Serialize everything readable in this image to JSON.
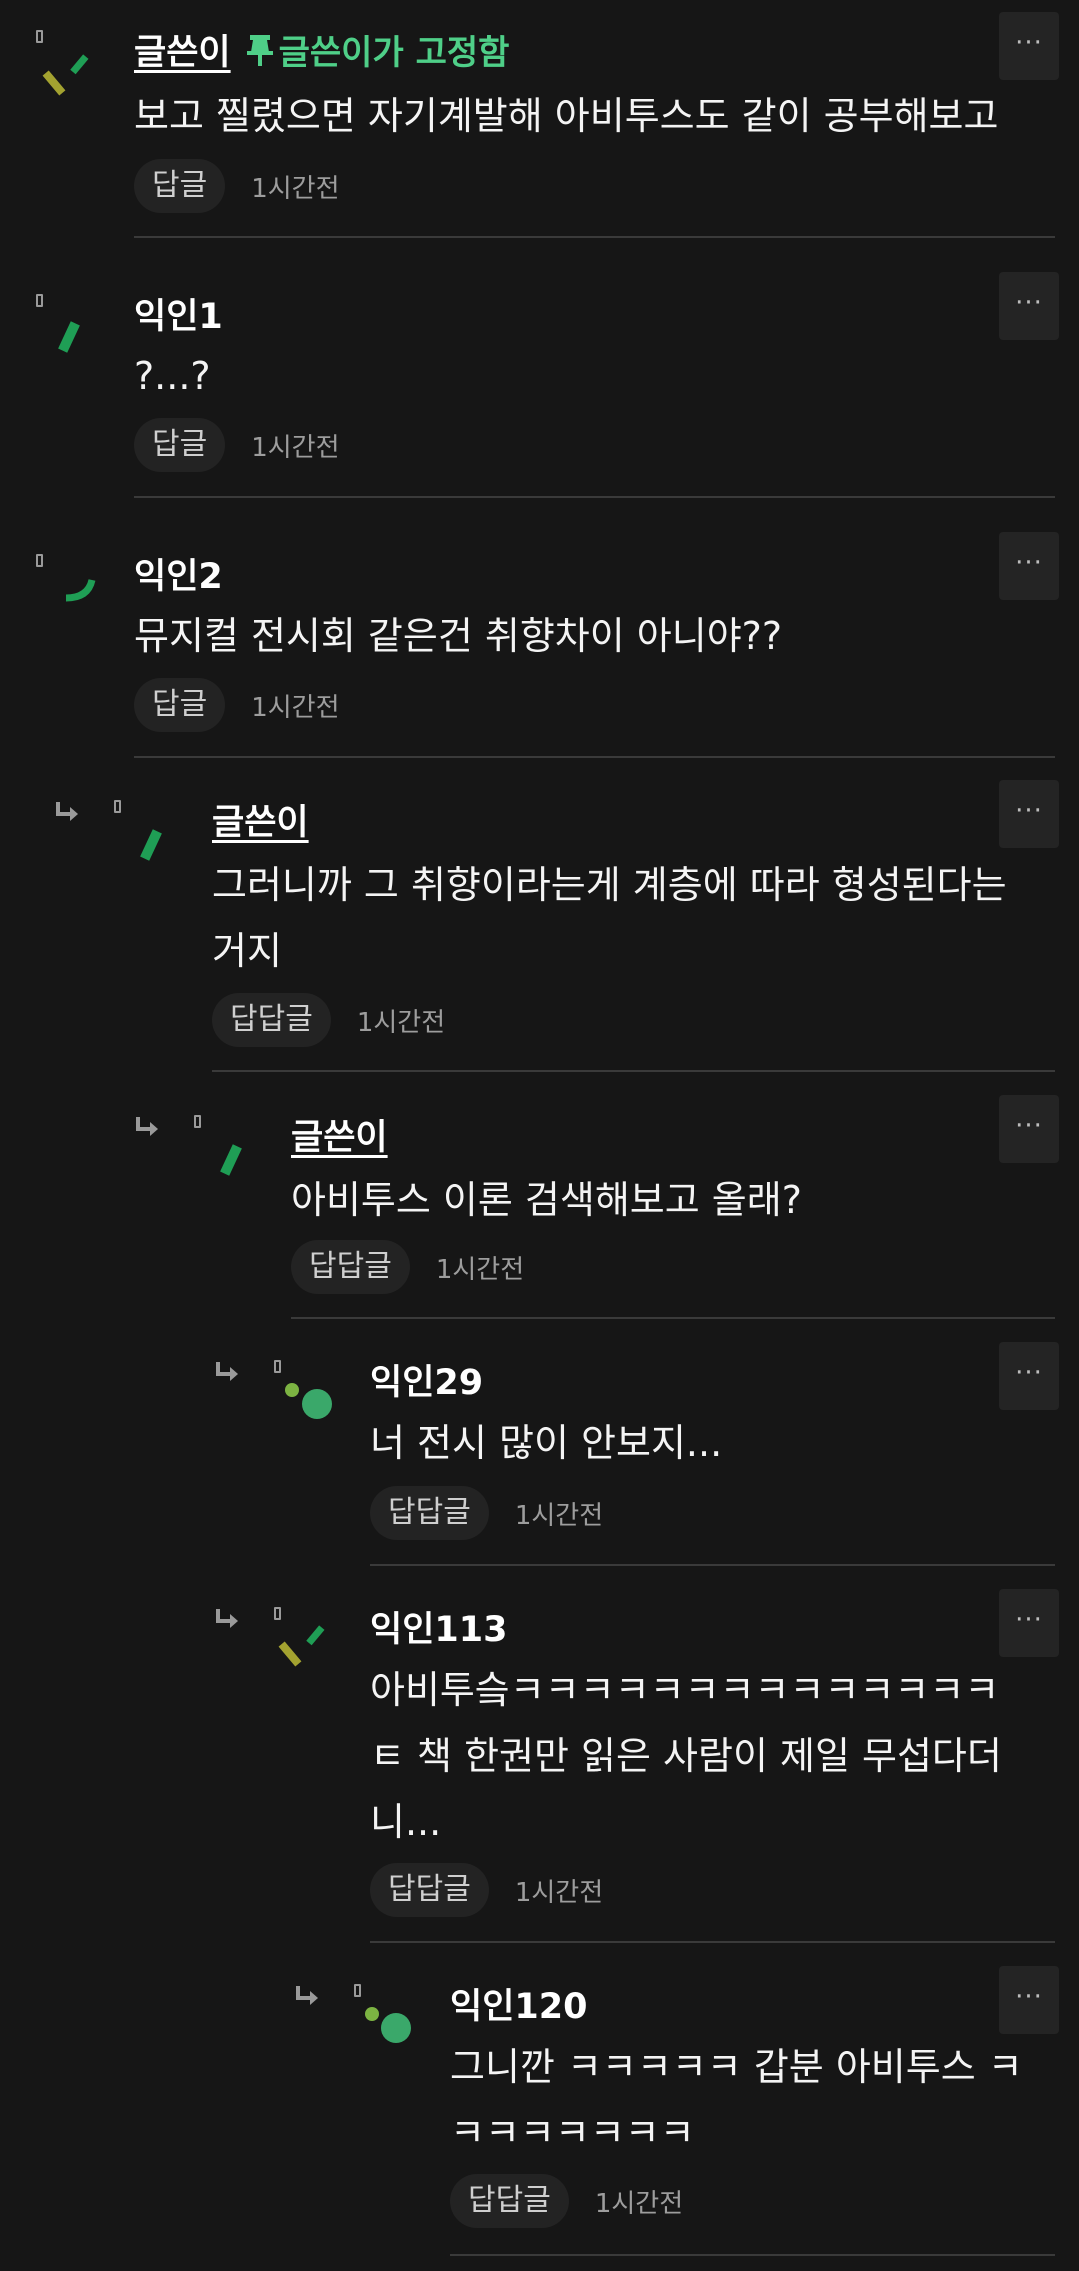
{
  "comments": [
    {
      "author": "글쓴이",
      "pinned": "글쓴이가 고정함",
      "text": "보고 찔렸으면 자기계발해 아비투스도 같이 공부해보고",
      "reply": "답글",
      "time": "1시간전",
      "more": "···"
    },
    {
      "author": "익인1",
      "text": "?...?",
      "reply": "답글",
      "time": "1시간전",
      "more": "···"
    },
    {
      "author": "익인2",
      "text": "뮤지컬 전시회 같은건 취향차이 아니야??",
      "reply": "답글",
      "time": "1시간전",
      "more": "···"
    },
    {
      "author": "글쓴이",
      "text": "그러니까 그 취향이라는게 계층에 따라 형성된다는\n거지",
      "reply": "답답글",
      "time": "1시간전",
      "more": "···"
    },
    {
      "author": "글쓴이",
      "text": "아비투스 이론 검색해보고 올래?",
      "reply": "답답글",
      "time": "1시간전",
      "more": "···"
    },
    {
      "author": "익인29",
      "text": "너 전시 많이 안보지...",
      "reply": "답답글",
      "time": "1시간전",
      "more": "···"
    },
    {
      "author": "익인113",
      "text": "아비투슼ㅋㅋㅋㅋㅋㅋㅋㅋㅋㅋㅋㅋㅋㅋ\nㅌ 책 한권만 읽은 사람이 제일 무섭다더\n니...",
      "reply": "답답글",
      "time": "1시간전",
      "more": "···"
    },
    {
      "author": "익인120",
      "text": "그니깐 ㅋㅋㅋㅋㅋ 갑분 아비투스 ㅋ\nㅋㅋㅋㅋㅋㅋㅋ",
      "reply": "답답글",
      "time": "1시간전",
      "more": "···"
    }
  ],
  "icons": {
    "pin": "pin-icon",
    "reply_arrow": "reply-arrow-icon",
    "more": "more-icon"
  },
  "colors": {
    "background": "#161616",
    "accent_green": "#4fcf88",
    "divider": "#3a3a3a"
  }
}
